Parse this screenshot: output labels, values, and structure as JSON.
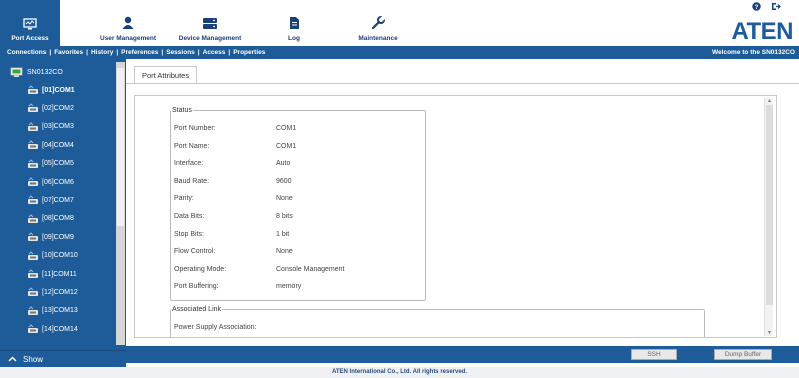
{
  "nav": {
    "items": [
      {
        "label": "Port Access",
        "icon": "monitor-icon",
        "active": true
      },
      {
        "label": "User Management",
        "icon": "user-icon"
      },
      {
        "label": "Device Management",
        "icon": "server-icon"
      },
      {
        "label": "Log",
        "icon": "document-icon"
      },
      {
        "label": "Maintenance",
        "icon": "wrench-icon"
      }
    ],
    "logo": "ATEN"
  },
  "subbar": {
    "links": [
      "Connections",
      "Favorites",
      "History",
      "Preferences",
      "Sessions",
      "Access",
      "Properties"
    ],
    "welcome": "Welcome to the SN0132CO"
  },
  "sidebar": {
    "root": "SN0132CO",
    "ports": [
      "[01]COM1",
      "[02]COM2",
      "[03]COM3",
      "[04]COM4",
      "[05]COM5",
      "[06]COM6",
      "[07]COM7",
      "[08]COM8",
      "[09]COM9",
      "[10]COM10",
      "[11]COM11",
      "[12]COM12",
      "[13]COM13",
      "[14]COM14"
    ],
    "show_label": "Show"
  },
  "main": {
    "tab": "Port Attributes",
    "status": {
      "legend": "Status",
      "rows": [
        {
          "label": "Port Number:",
          "value": "COM1"
        },
        {
          "label": "Port Name:",
          "value": "COM1"
        },
        {
          "label": "Interface:",
          "value": "Auto"
        },
        {
          "label": "Baud Rate:",
          "value": "9600"
        },
        {
          "label": "Parity:",
          "value": "None"
        },
        {
          "label": "Data Bits:",
          "value": "8 bits"
        },
        {
          "label": "Stop Bits:",
          "value": "1 bit"
        },
        {
          "label": "Flow Control:",
          "value": "None"
        },
        {
          "label": "Operating Mode:",
          "value": "Console Management"
        },
        {
          "label": "Port Buffering:",
          "value": "memory"
        }
      ]
    },
    "assoc": {
      "legend": "Associated Link",
      "row": "Power Supply Association:"
    }
  },
  "actions": {
    "ssh": "SSH",
    "dump": "Dump Buffer"
  },
  "footer": "ATEN International Co., Ltd. All rights reserved.",
  "colors": {
    "brand": "#1e5c99",
    "logo": "#1e5a9e"
  }
}
